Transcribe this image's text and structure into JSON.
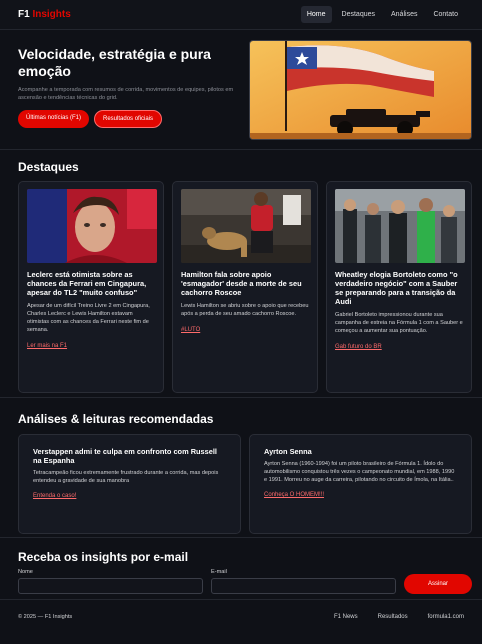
{
  "brand": {
    "prefix": "F1",
    "accent": "Insights"
  },
  "nav": [
    "Home",
    "Destaques",
    "Análises",
    "Contato"
  ],
  "hero": {
    "title": "Velocidade, estratégia e pura emoção",
    "subtitle": "Acompanhe a temporada com resumos de corrida, movimentos de equipes, pilotos em ascensão e tendências técnicas do grid.",
    "btn_primary": "Últimas notícias (F1)",
    "btn_secondary": "Resultados oficiais"
  },
  "destaques": {
    "title": "Destaques",
    "cards": [
      {
        "title": "Leclerc está otimista sobre as chances da Ferrari em Cingapura, apesar do TL2 \"muito confuso\"",
        "text": "Apesar de um difícil Treino Livre 2 em Cingapura, Charles Leclerc e Lewis Hamilton estavam otimistas com as chances da Ferrari neste fim de semana.",
        "link": "Ler mais na F1"
      },
      {
        "title": "Hamilton fala sobre apoio 'esmagador' desde a morte de seu cachorro Roscoe",
        "text": "Lewis Hamilton se abriu sobre o apoio que recebeu após a perda de seu amado cachorro Roscoe.",
        "link": "#LUTO"
      },
      {
        "title": "Wheatley elogia Bortoleto como \"o verdadeiro negócio\" com a Sauber se preparando para a transição da Audi",
        "text": "Gabriel Bortoleto impressionou durante sua campanha de estreia na Fórmula 1 com a Sauber e começou a aumentar sua pontuação.",
        "link": "Gab futuro do BR"
      }
    ]
  },
  "analises": {
    "title": "Análises & leituras recomendadas",
    "cards": [
      {
        "title": "Verstappen admi te culpa em confronto com Russell na Espanha",
        "text": "Tetracampeão ficou extremamente frustrado durante a corrida, mas depois entendeu a gravidade de sua manobra",
        "link": "Entenda o caso!"
      },
      {
        "title": "Ayrton Senna",
        "text": "Ayrton Senna (1960-1994) foi um piloto brasileiro de Fórmula 1. Ídolo do automobilismo conquistou três vezes o campeonato mundial, em 1988, 1990 e 1991. Morreu no auge da carreira, pilotando no circuito de Ímola, na Itália..",
        "link": "Conheça O HOMEM!!!"
      }
    ]
  },
  "newsletter": {
    "title": "Receba os insights por e-mail",
    "name_label": "Nome",
    "email_label": "E-mail",
    "submit": "Assinar"
  },
  "footer": {
    "copy": "© 2025 — F1 Insights",
    "links": [
      "F1 News",
      "Resultados",
      "formula1.com"
    ]
  },
  "colors": {
    "accent": "#e10600",
    "link": "#ff6b6b",
    "bg": "#0f1117",
    "card": "#161922"
  }
}
